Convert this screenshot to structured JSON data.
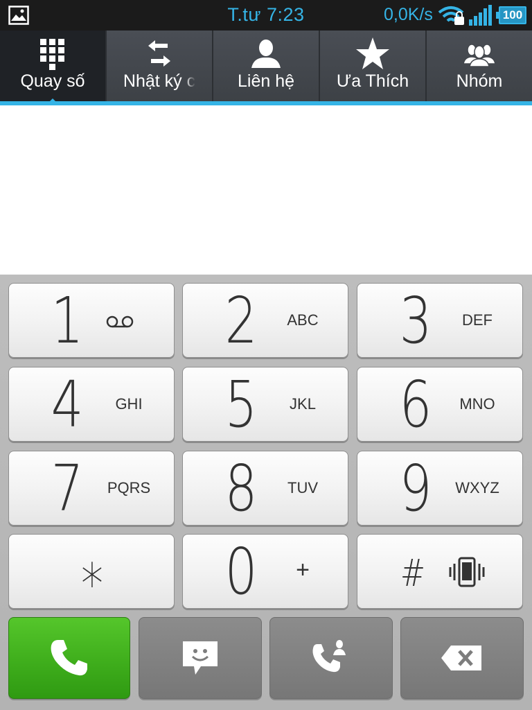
{
  "status_bar": {
    "time": "T.tư 7:23",
    "net_speed": "0,0K/s",
    "battery": "100",
    "icons": [
      "gallery-icon",
      "wifi-lock-icon",
      "signal-icon",
      "battery-icon"
    ]
  },
  "tabs": [
    {
      "label": "Quay số",
      "icon": "dialpad-icon",
      "active": true
    },
    {
      "label": "Nhật ký c",
      "icon": "call-log-icon",
      "active": false
    },
    {
      "label": "Liên hệ",
      "icon": "contact-icon",
      "active": false
    },
    {
      "label": "Ưa Thích",
      "icon": "star-icon",
      "active": false
    },
    {
      "label": "Nhóm",
      "icon": "group-icon",
      "active": false
    }
  ],
  "dial_input": {
    "value": ""
  },
  "keys": [
    {
      "digit": "1",
      "letters": "",
      "icon": "voicemail-icon"
    },
    {
      "digit": "2",
      "letters": "ABC"
    },
    {
      "digit": "3",
      "letters": "DEF"
    },
    {
      "digit": "4",
      "letters": "GHI"
    },
    {
      "digit": "5",
      "letters": "JKL"
    },
    {
      "digit": "6",
      "letters": "MNO"
    },
    {
      "digit": "7",
      "letters": "PQRS"
    },
    {
      "digit": "8",
      "letters": "TUV"
    },
    {
      "digit": "9",
      "letters": "WXYZ"
    },
    {
      "digit": "*",
      "letters": ""
    },
    {
      "digit": "0",
      "letters": "+"
    },
    {
      "digit": "#",
      "letters": "",
      "icon": "vibrate-icon"
    }
  ],
  "actions": [
    {
      "name": "call",
      "icon": "phone-icon"
    },
    {
      "name": "message",
      "icon": "message-icon"
    },
    {
      "name": "add-call",
      "icon": "add-to-contact-icon"
    },
    {
      "name": "delete",
      "icon": "backspace-icon"
    }
  ],
  "colors": {
    "accent": "#35b4e6",
    "call_green": "#45b51f",
    "tab_bg": "#43474d",
    "active_tab": "#1f2226"
  }
}
